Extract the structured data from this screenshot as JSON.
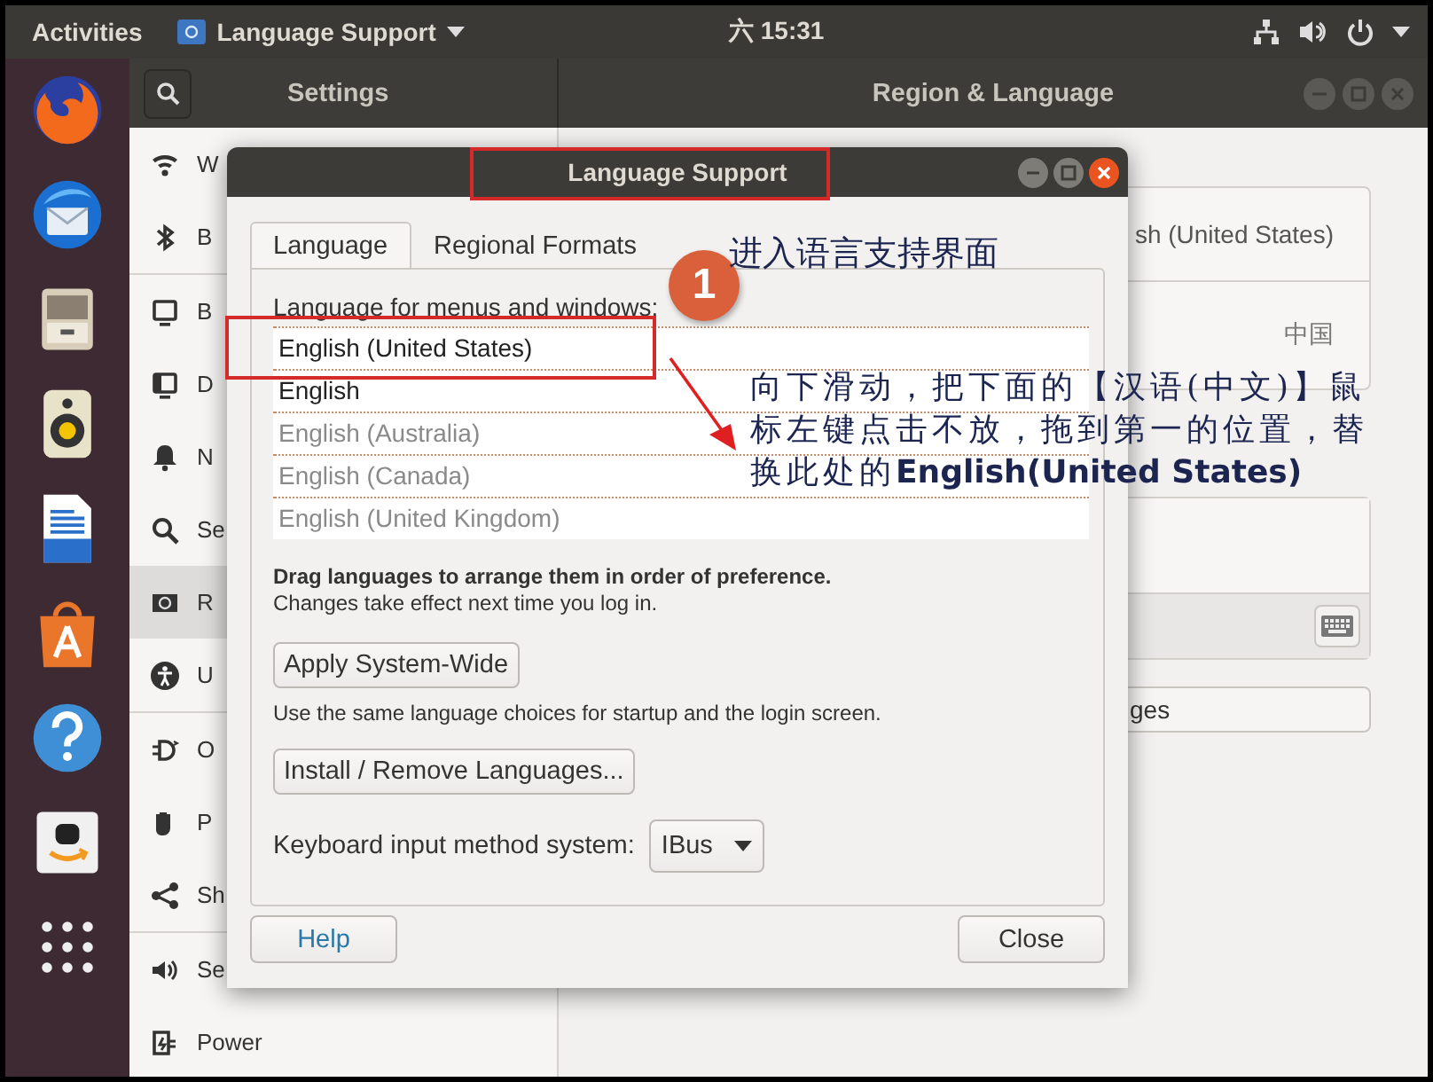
{
  "top_bar": {
    "activities": "Activities",
    "app_name": "Language Support",
    "clock": "六 15:31"
  },
  "settings": {
    "title": "Settings",
    "panel_title": "Region & Language",
    "sidebar": {
      "groups": [
        [
          {
            "label": "W",
            "selected": false
          },
          {
            "label": "B",
            "selected": false
          }
        ],
        [
          {
            "label": "B",
            "selected": false
          },
          {
            "label": "D",
            "selected": false
          },
          {
            "label": "N",
            "selected": false
          },
          {
            "label": "Se",
            "selected": false
          },
          {
            "label": "R",
            "selected": true
          },
          {
            "label": "U",
            "selected": false
          }
        ],
        [
          {
            "label": "O",
            "selected": false
          },
          {
            "label": "P",
            "selected": false
          },
          {
            "label": "Sh",
            "selected": false
          }
        ],
        [
          {
            "label": "Se",
            "selected": false
          },
          {
            "label": "Power",
            "selected": false
          }
        ]
      ]
    },
    "region_panel": {
      "language_value": "sh (United States)",
      "formats_value": "中国",
      "manage_button": "ges"
    }
  },
  "dialog": {
    "title": "Language Support",
    "tabs": [
      {
        "label": "Language",
        "selected": true
      },
      {
        "label": "Regional Formats",
        "selected": false
      }
    ],
    "list_label": "Language for menus and windows:",
    "languages": [
      {
        "label": "English (United States)",
        "disabled": false
      },
      {
        "label": "English",
        "disabled": false
      },
      {
        "label": "English (Australia)",
        "disabled": true
      },
      {
        "label": "English (Canada)",
        "disabled": true
      },
      {
        "label": "English (United Kingdom)",
        "disabled": true
      }
    ],
    "drag_hint": "Drag languages to arrange them in order of preference.",
    "drag_note": "Changes take effect next time you log in.",
    "apply_button": "Apply System-Wide",
    "apply_note": "Use the same language choices for startup and the login screen.",
    "install_button": "Install / Remove Languages...",
    "keyboard_label": "Keyboard input method system:",
    "keyboard_value": "IBus",
    "help_button": "Help",
    "close_button": "Close"
  },
  "annotations": {
    "step_number": "1",
    "caption": "进入语言支持界面",
    "instruction": "向下滑动，把下面的【汉语(中文)】鼠标左键点击不放，拖到第一的位置，替换此处的**English(United States)**"
  }
}
